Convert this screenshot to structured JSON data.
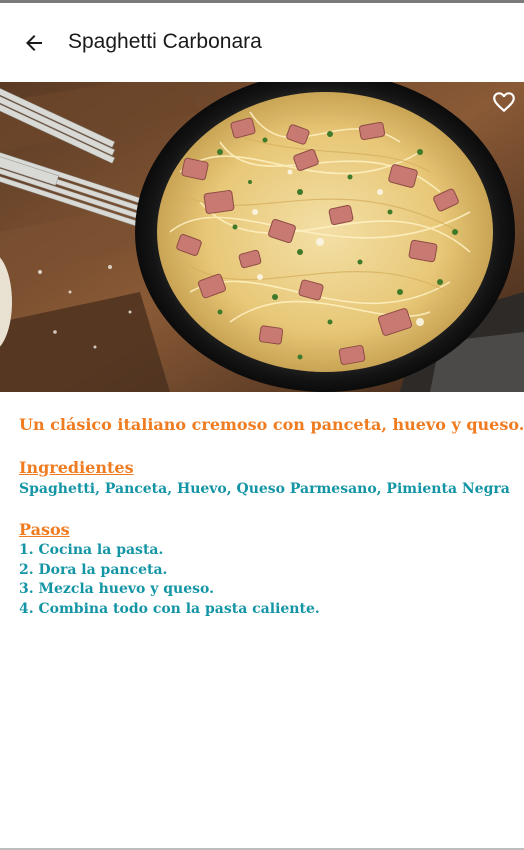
{
  "app_bar": {
    "title": "Spaghetti Carbonara",
    "back_icon": "arrow-left-icon"
  },
  "hero": {
    "image_subject": "spaghetti carbonara in cast iron skillet with forks",
    "favorite_icon": "heart-outline-icon"
  },
  "recipe": {
    "description": "Un clásico italiano cremoso con panceta, huevo y queso.",
    "ingredients_heading": "Ingredientes",
    "ingredients": "Spaghetti, Panceta, Huevo, Queso Parmesano, Pimienta Negra",
    "steps_heading": "Pasos",
    "steps": [
      "1. Cocina la pasta.",
      "2. Dora la panceta.",
      "3. Mezcla huevo y queso.",
      "4. Combina todo con la pasta caliente."
    ]
  },
  "colors": {
    "accent_orange": "#f07c22",
    "accent_teal": "#1495a6",
    "title_text": "#1a1a1a"
  }
}
